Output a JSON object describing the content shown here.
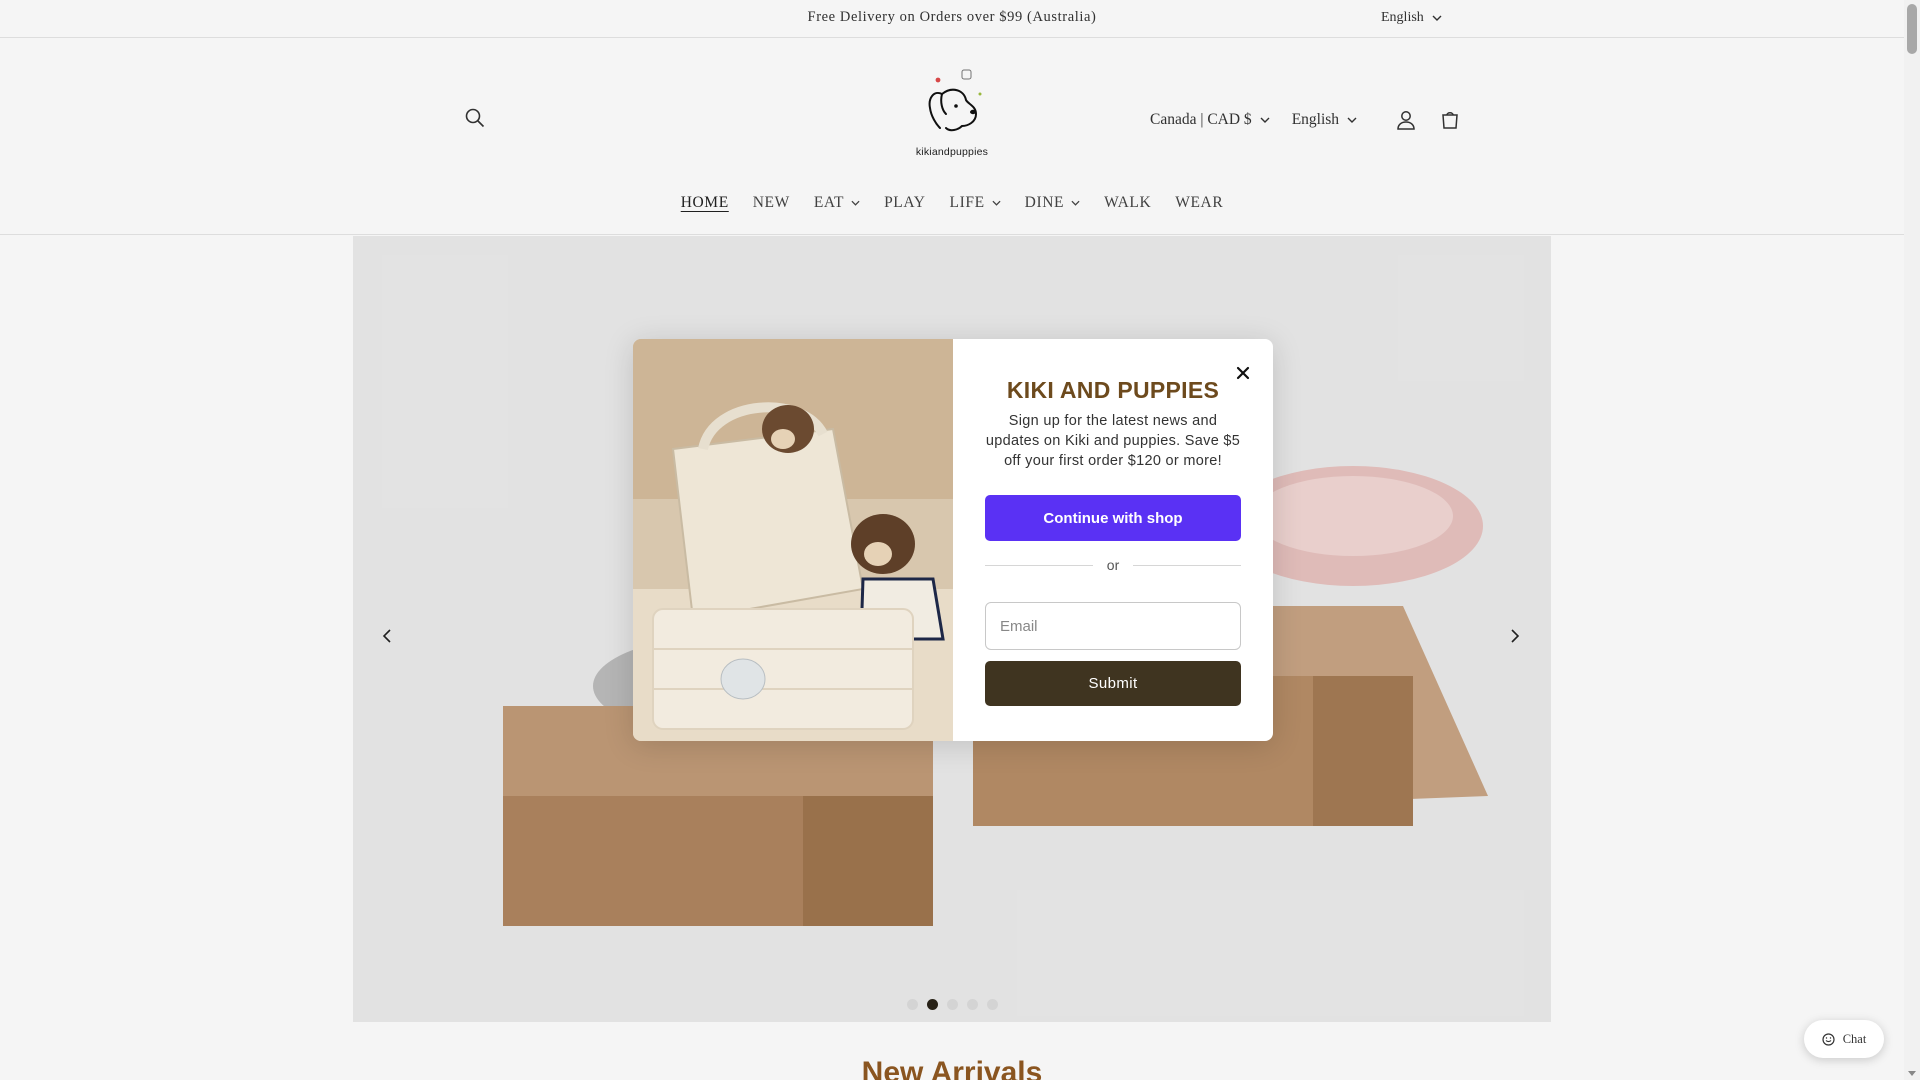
{
  "announcement": {
    "message": "Free Delivery on Orders over $99 (Australia)",
    "language": "English"
  },
  "header": {
    "brand": "kikiandpuppies",
    "country": "Canada | CAD $",
    "language": "English",
    "icons": [
      "search-icon",
      "account-icon",
      "cart-icon"
    ]
  },
  "nav": {
    "items": [
      {
        "label": "HOME",
        "dropdown": false,
        "active": true
      },
      {
        "label": "NEW",
        "dropdown": false,
        "active": false
      },
      {
        "label": "EAT",
        "dropdown": true,
        "active": false
      },
      {
        "label": "PLAY",
        "dropdown": false,
        "active": false
      },
      {
        "label": "LIFE",
        "dropdown": true,
        "active": false
      },
      {
        "label": "DINE",
        "dropdown": true,
        "active": false
      },
      {
        "label": "WALK",
        "dropdown": false,
        "active": false
      },
      {
        "label": "WEAR",
        "dropdown": false,
        "active": false
      }
    ]
  },
  "slideshow": {
    "slide_count": 5,
    "active_slide": 2
  },
  "modal": {
    "title": "KIKI AND PUPPIES",
    "text": "Sign up for the latest news and updates on Kiki and puppies. Save $5 off your first order $120 or more!",
    "shop_button": "Continue with shop",
    "or": "or",
    "email_placeholder": "Email",
    "submit": "Submit"
  },
  "section_title": "New Arrivals",
  "chat_label": "Chat",
  "colors": {
    "accent_title": "#6d4a1d",
    "shop_button": "#5a31f4",
    "submit_button": "#3f3420",
    "section_title": "#8a5520"
  }
}
